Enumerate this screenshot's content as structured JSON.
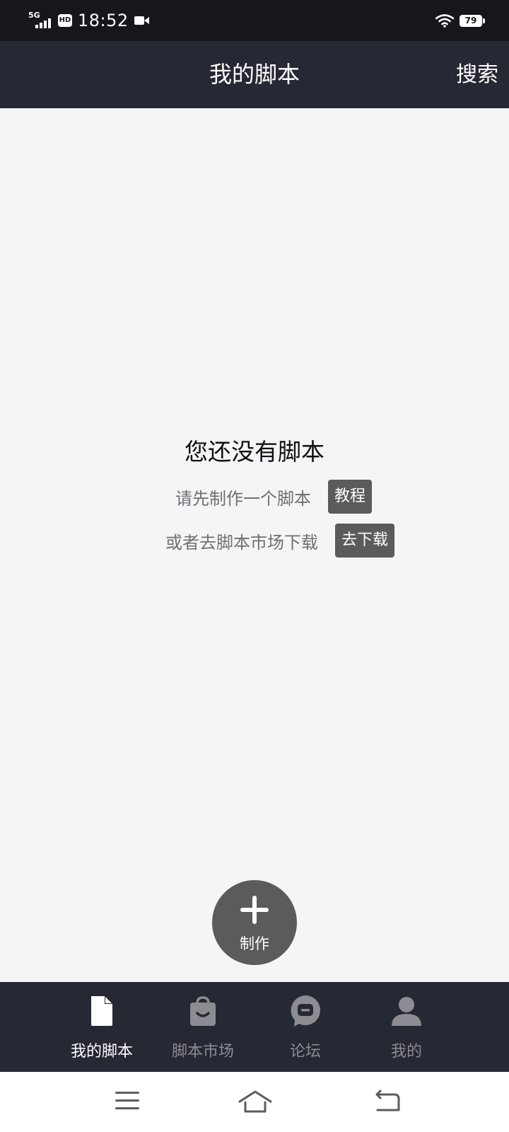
{
  "status_bar": {
    "network": "5G",
    "hd": "HD",
    "time": "18:52",
    "battery": "79"
  },
  "header": {
    "title": "我的脚本",
    "search": "搜索"
  },
  "empty_state": {
    "title": "您还没有脚本",
    "line1": "请先制作一个脚本",
    "tutorial_button": "教程",
    "line2": "或者去脚本市场下载",
    "download_button": "去下载"
  },
  "fab": {
    "label": "制作"
  },
  "tabs": [
    {
      "label": "我的脚本",
      "icon": "document-icon",
      "active": true
    },
    {
      "label": "脚本市场",
      "icon": "shopping-bag-icon",
      "active": false
    },
    {
      "label": "论坛",
      "icon": "chat-bubble-icon",
      "active": false
    },
    {
      "label": "我的",
      "icon": "person-icon",
      "active": false
    }
  ],
  "colors": {
    "header_bg": "#262834",
    "status_bar_bg": "#16171c",
    "content_bg": "#f5f5f8",
    "button_gray": "#5b5b5e",
    "tab_inactive": "#8c8c92"
  }
}
